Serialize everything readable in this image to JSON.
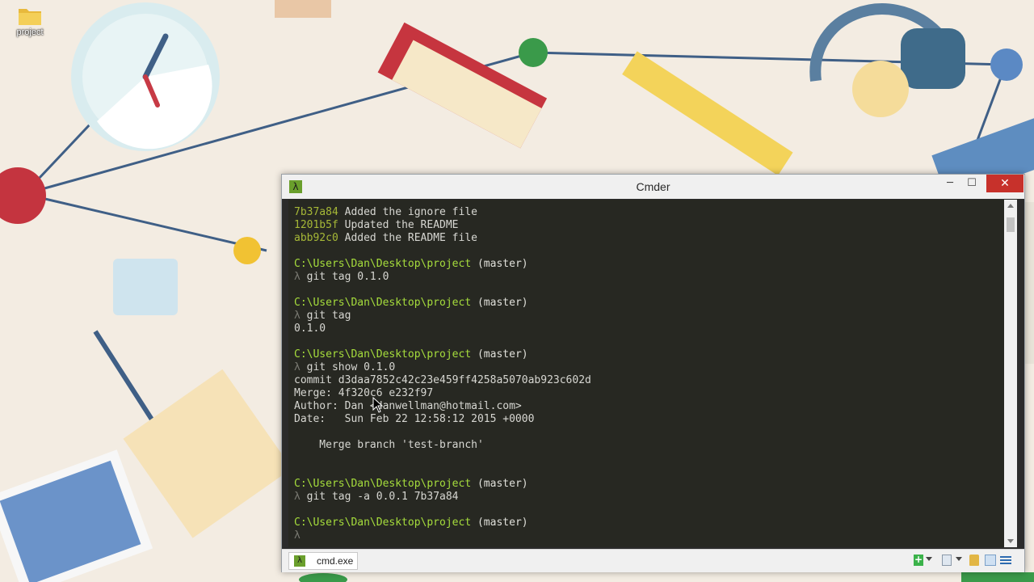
{
  "desktop": {
    "icons": [
      {
        "label": "project",
        "icon": "folder-icon"
      }
    ]
  },
  "window": {
    "title": "Cmder",
    "app_icon": "λ",
    "controls": {
      "minimize": "─",
      "maximize": "☐",
      "close": "✕"
    }
  },
  "console": {
    "lines": [
      {
        "hash": "7b37a84",
        "text": " Added the ignore file"
      },
      {
        "hash": "1201b5f",
        "text": " Updated the README"
      },
      {
        "hash": "abb92c0",
        "text": " Added the README file"
      },
      {
        "path": "C:\\Users\\Dan\\Desktop\\project",
        "branch": " (master)"
      },
      {
        "lambda": "λ",
        "text": " git tag 0.1.0"
      },
      {
        "path": "C:\\Users\\Dan\\Desktop\\project",
        "branch": " (master)"
      },
      {
        "lambda": "λ",
        "text": " git tag"
      },
      {
        "text": "0.1.0"
      },
      {
        "path": "C:\\Users\\Dan\\Desktop\\project",
        "branch": " (master)"
      },
      {
        "lambda": "λ",
        "text": " git show 0.1.0"
      },
      {
        "commit": "commit d3daa7852c42c23e459ff4258a5070ab923c602d"
      },
      {
        "text": "Merge: 4f320c6 e232f97"
      },
      {
        "text": "Author: Dan <danwellman@hotmail.com>"
      },
      {
        "text": "Date:   Sun Feb 22 12:58:12 2015 +0000"
      },
      {
        "text": "    Merge branch 'test-branch'"
      },
      {
        "path": "C:\\Users\\Dan\\Desktop\\project",
        "branch": " (master)"
      },
      {
        "lambda": "λ",
        "text": " git tag -a 0.0.1 7b37a84"
      },
      {
        "path": "C:\\Users\\Dan\\Desktop\\project",
        "branch": " (master)"
      },
      {
        "lambda": "λ",
        "text": ""
      }
    ]
  },
  "statusbar": {
    "tab_label": "cmd.exe",
    "tab_icon": "λ",
    "new_console": "+"
  },
  "colors": {
    "console_bg": "#272822",
    "hash": "#a6b837",
    "path": "#a6dd3c",
    "close_button": "#c7312b"
  }
}
